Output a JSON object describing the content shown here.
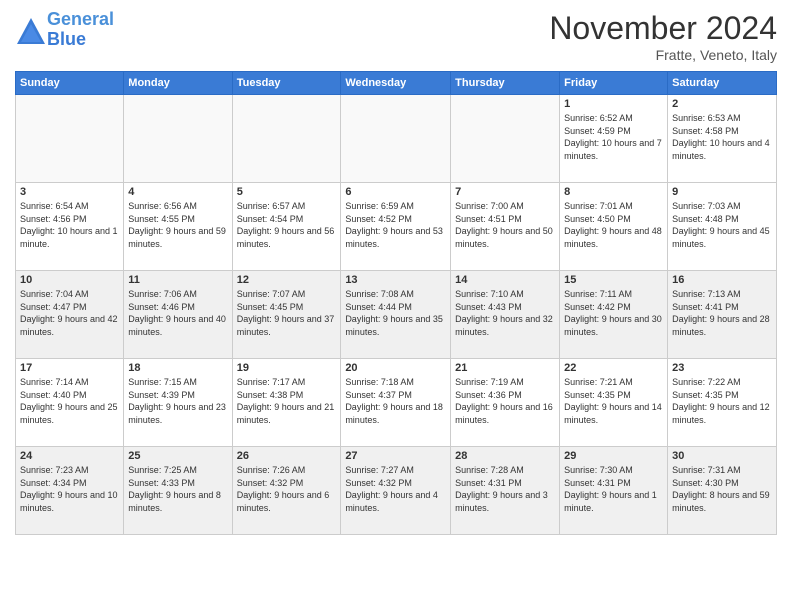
{
  "logo": {
    "line1": "General",
    "line2": "Blue"
  },
  "title": "November 2024",
  "location": "Fratte, Veneto, Italy",
  "header": {
    "days": [
      "Sunday",
      "Monday",
      "Tuesday",
      "Wednesday",
      "Thursday",
      "Friday",
      "Saturday"
    ]
  },
  "weeks": [
    [
      {
        "day": "",
        "info": ""
      },
      {
        "day": "",
        "info": ""
      },
      {
        "day": "",
        "info": ""
      },
      {
        "day": "",
        "info": ""
      },
      {
        "day": "",
        "info": ""
      },
      {
        "day": "1",
        "info": "Sunrise: 6:52 AM\nSunset: 4:59 PM\nDaylight: 10 hours and 7 minutes."
      },
      {
        "day": "2",
        "info": "Sunrise: 6:53 AM\nSunset: 4:58 PM\nDaylight: 10 hours and 4 minutes."
      }
    ],
    [
      {
        "day": "3",
        "info": "Sunrise: 6:54 AM\nSunset: 4:56 PM\nDaylight: 10 hours and 1 minute."
      },
      {
        "day": "4",
        "info": "Sunrise: 6:56 AM\nSunset: 4:55 PM\nDaylight: 9 hours and 59 minutes."
      },
      {
        "day": "5",
        "info": "Sunrise: 6:57 AM\nSunset: 4:54 PM\nDaylight: 9 hours and 56 minutes."
      },
      {
        "day": "6",
        "info": "Sunrise: 6:59 AM\nSunset: 4:52 PM\nDaylight: 9 hours and 53 minutes."
      },
      {
        "day": "7",
        "info": "Sunrise: 7:00 AM\nSunset: 4:51 PM\nDaylight: 9 hours and 50 minutes."
      },
      {
        "day": "8",
        "info": "Sunrise: 7:01 AM\nSunset: 4:50 PM\nDaylight: 9 hours and 48 minutes."
      },
      {
        "day": "9",
        "info": "Sunrise: 7:03 AM\nSunset: 4:48 PM\nDaylight: 9 hours and 45 minutes."
      }
    ],
    [
      {
        "day": "10",
        "info": "Sunrise: 7:04 AM\nSunset: 4:47 PM\nDaylight: 9 hours and 42 minutes."
      },
      {
        "day": "11",
        "info": "Sunrise: 7:06 AM\nSunset: 4:46 PM\nDaylight: 9 hours and 40 minutes."
      },
      {
        "day": "12",
        "info": "Sunrise: 7:07 AM\nSunset: 4:45 PM\nDaylight: 9 hours and 37 minutes."
      },
      {
        "day": "13",
        "info": "Sunrise: 7:08 AM\nSunset: 4:44 PM\nDaylight: 9 hours and 35 minutes."
      },
      {
        "day": "14",
        "info": "Sunrise: 7:10 AM\nSunset: 4:43 PM\nDaylight: 9 hours and 32 minutes."
      },
      {
        "day": "15",
        "info": "Sunrise: 7:11 AM\nSunset: 4:42 PM\nDaylight: 9 hours and 30 minutes."
      },
      {
        "day": "16",
        "info": "Sunrise: 7:13 AM\nSunset: 4:41 PM\nDaylight: 9 hours and 28 minutes."
      }
    ],
    [
      {
        "day": "17",
        "info": "Sunrise: 7:14 AM\nSunset: 4:40 PM\nDaylight: 9 hours and 25 minutes."
      },
      {
        "day": "18",
        "info": "Sunrise: 7:15 AM\nSunset: 4:39 PM\nDaylight: 9 hours and 23 minutes."
      },
      {
        "day": "19",
        "info": "Sunrise: 7:17 AM\nSunset: 4:38 PM\nDaylight: 9 hours and 21 minutes."
      },
      {
        "day": "20",
        "info": "Sunrise: 7:18 AM\nSunset: 4:37 PM\nDaylight: 9 hours and 18 minutes."
      },
      {
        "day": "21",
        "info": "Sunrise: 7:19 AM\nSunset: 4:36 PM\nDaylight: 9 hours and 16 minutes."
      },
      {
        "day": "22",
        "info": "Sunrise: 7:21 AM\nSunset: 4:35 PM\nDaylight: 9 hours and 14 minutes."
      },
      {
        "day": "23",
        "info": "Sunrise: 7:22 AM\nSunset: 4:35 PM\nDaylight: 9 hours and 12 minutes."
      }
    ],
    [
      {
        "day": "24",
        "info": "Sunrise: 7:23 AM\nSunset: 4:34 PM\nDaylight: 9 hours and 10 minutes."
      },
      {
        "day": "25",
        "info": "Sunrise: 7:25 AM\nSunset: 4:33 PM\nDaylight: 9 hours and 8 minutes."
      },
      {
        "day": "26",
        "info": "Sunrise: 7:26 AM\nSunset: 4:32 PM\nDaylight: 9 hours and 6 minutes."
      },
      {
        "day": "27",
        "info": "Sunrise: 7:27 AM\nSunset: 4:32 PM\nDaylight: 9 hours and 4 minutes."
      },
      {
        "day": "28",
        "info": "Sunrise: 7:28 AM\nSunset: 4:31 PM\nDaylight: 9 hours and 3 minutes."
      },
      {
        "day": "29",
        "info": "Sunrise: 7:30 AM\nSunset: 4:31 PM\nDaylight: 9 hours and 1 minute."
      },
      {
        "day": "30",
        "info": "Sunrise: 7:31 AM\nSunset: 4:30 PM\nDaylight: 8 hours and 59 minutes."
      }
    ]
  ]
}
